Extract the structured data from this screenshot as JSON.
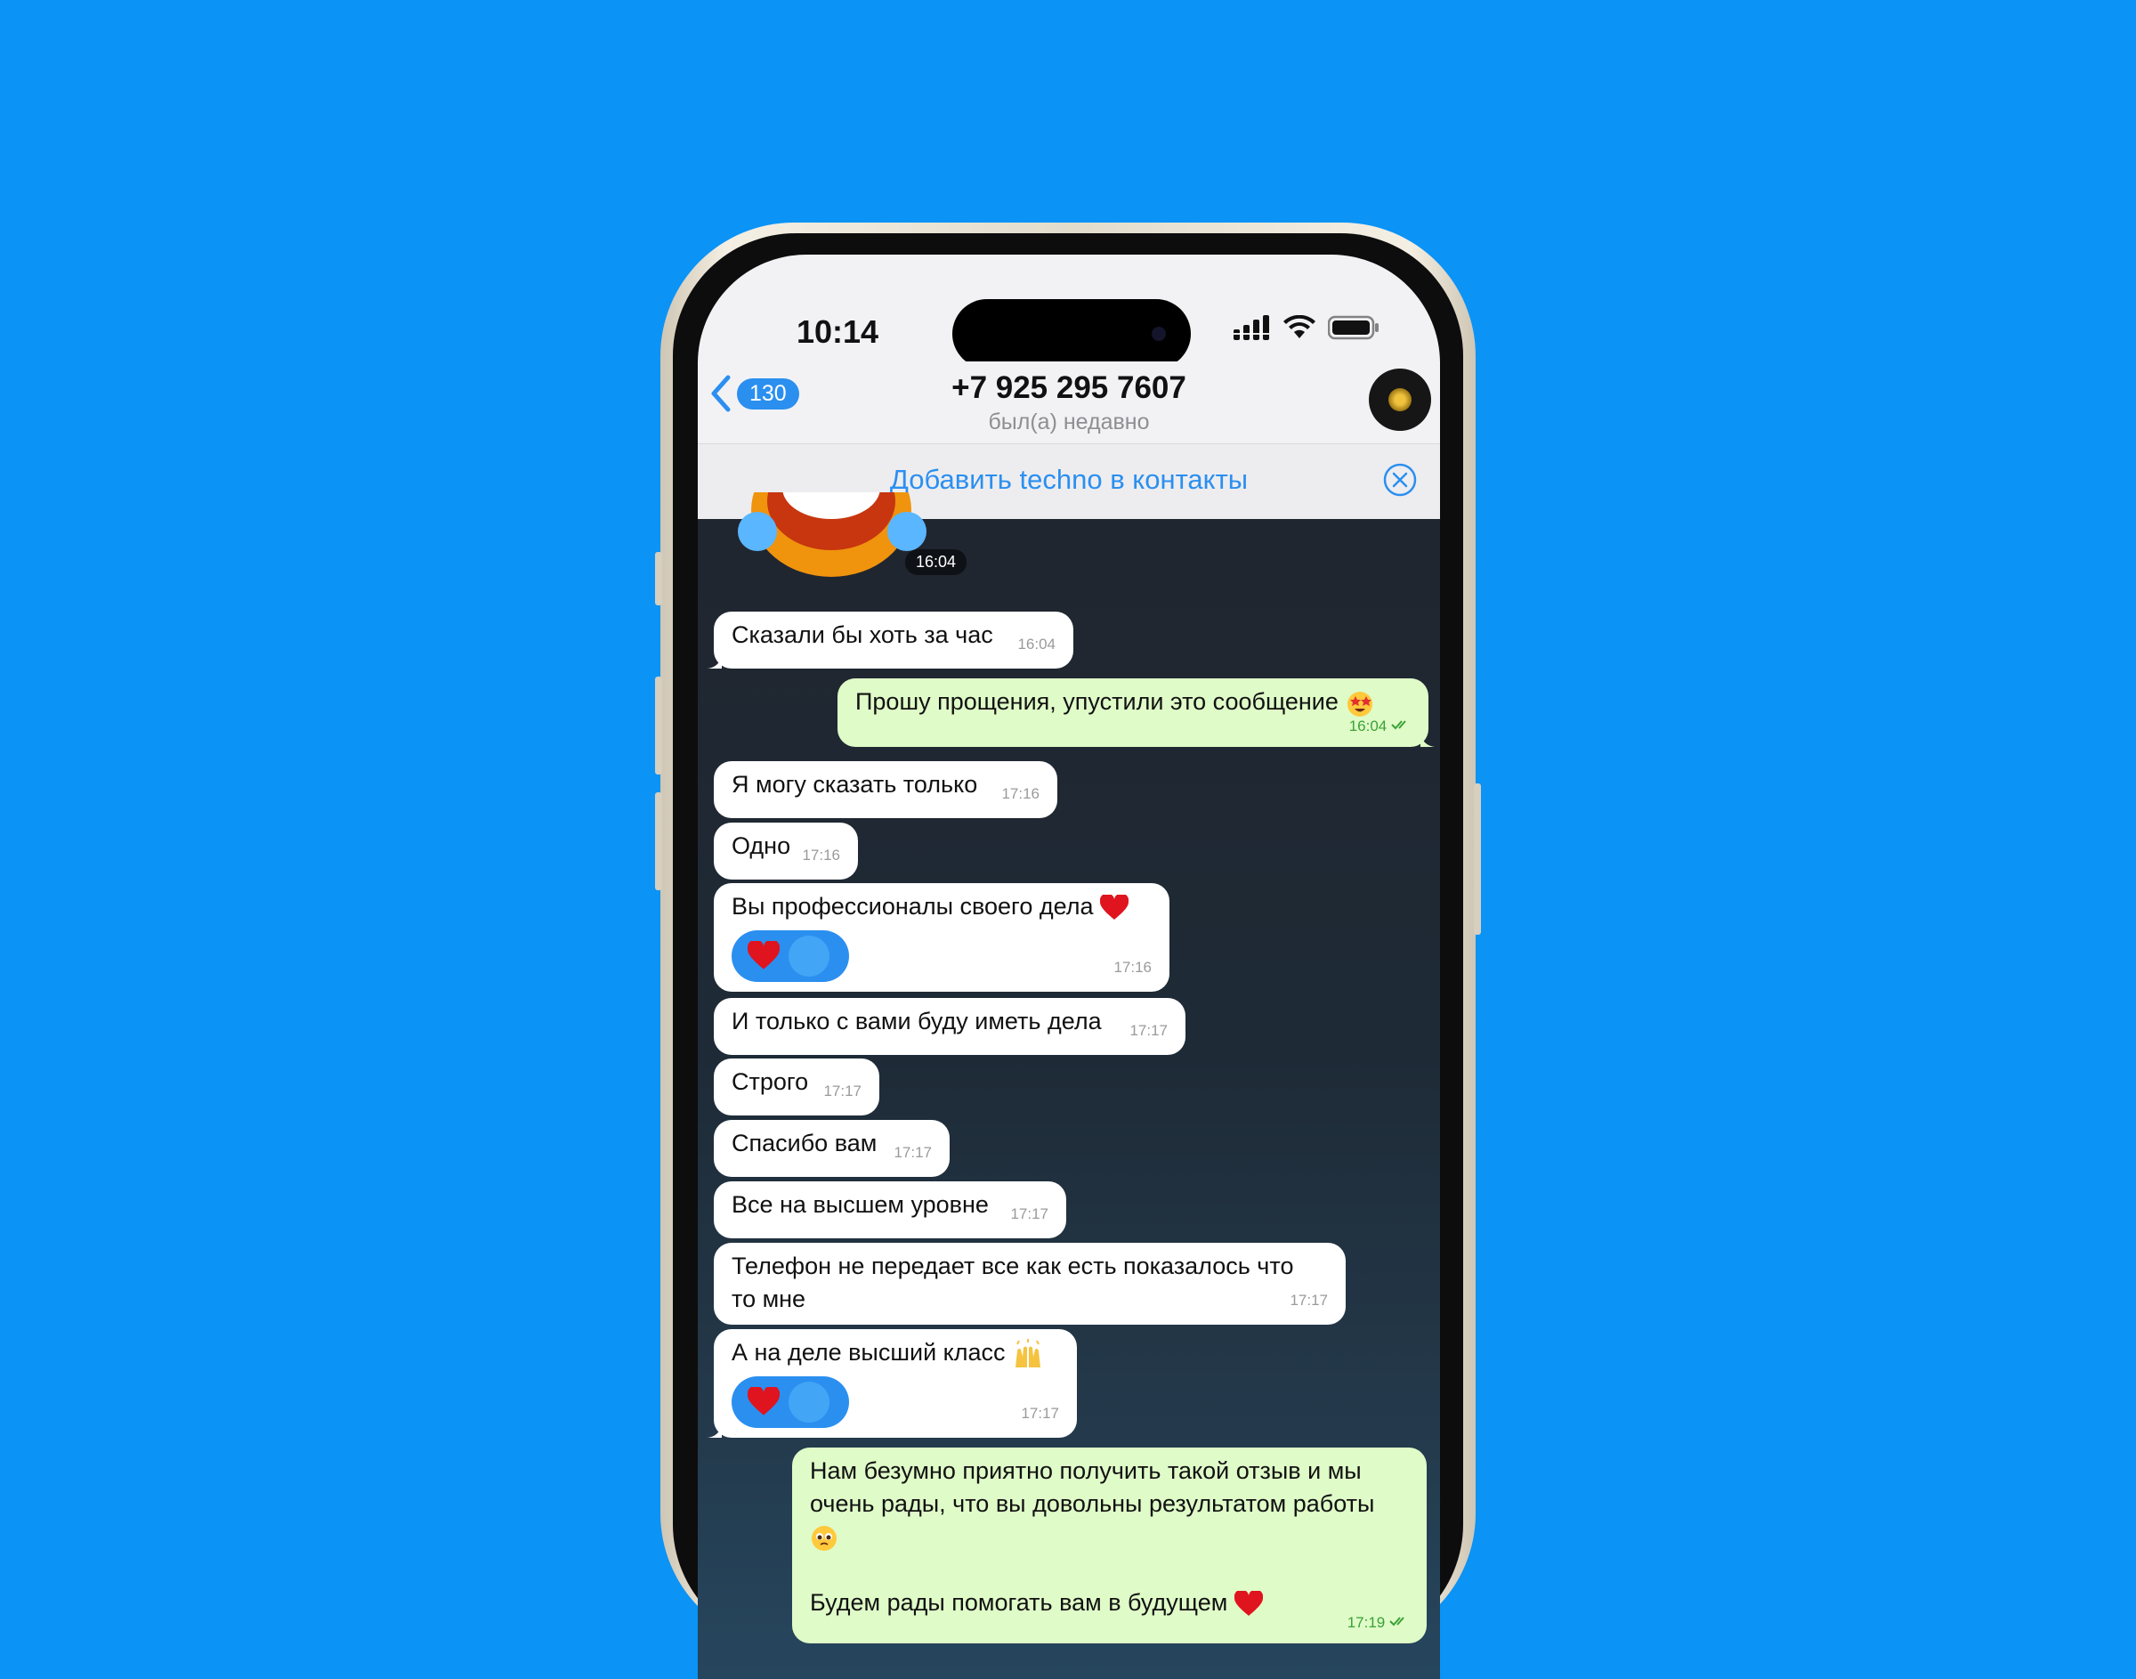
{
  "status": {
    "time": "10:14"
  },
  "header": {
    "back_count": "130",
    "title": "+7 925 295 7607",
    "subtitle": "был(а) недавно"
  },
  "add_contact": {
    "label": "Добавить techno в контакты"
  },
  "sticker": {
    "time": "16:04"
  },
  "messages": [
    {
      "dir": "in",
      "text": "Сказали бы хоть за час",
      "time": "16:04"
    },
    {
      "dir": "out",
      "text": "Прошу прощения, упустили это сообщение",
      "emoji": "star-struck-emoji",
      "time": "16:04"
    },
    {
      "dir": "in",
      "text": "Я могу сказать только",
      "time": "17:16"
    },
    {
      "dir": "in",
      "text": "Одно",
      "time": "17:16"
    },
    {
      "dir": "in",
      "text": "Вы профессионалы своего дела",
      "emoji": "red-heart-emoji",
      "time": "17:16",
      "reaction": "red-heart-emoji"
    },
    {
      "dir": "in",
      "text": "И только с вами буду иметь дела",
      "time": "17:17"
    },
    {
      "dir": "in",
      "text": "Строго",
      "time": "17:17"
    },
    {
      "dir": "in",
      "text": "Спасибо вам",
      "time": "17:17"
    },
    {
      "dir": "in",
      "text": "Все на высшем уровне",
      "time": "17:17"
    },
    {
      "dir": "in",
      "line1": "Телефон не передает все как есть показалось что",
      "line2": "то мне",
      "time": "17:17"
    },
    {
      "dir": "in",
      "text": "А на деле высший класс",
      "emoji": "raised-hands-emoji",
      "time": "17:17",
      "reaction": "red-heart-emoji"
    },
    {
      "dir": "out",
      "line1": "Нам безумно приятно получить такой отзыв и мы",
      "line2": "очень рады, что вы довольны результатом работы",
      "emoji": "pleading-face-emoji",
      "line4": "Будем рады помогать вам в будущем",
      "emoji2": "red-heart-emoji",
      "time": "17:19"
    }
  ],
  "colors": {
    "background": "#0b93f6",
    "accent": "#2b8ff0",
    "outgoing_bubble": "#dffbc8",
    "incoming_bubble": "#ffffff"
  }
}
